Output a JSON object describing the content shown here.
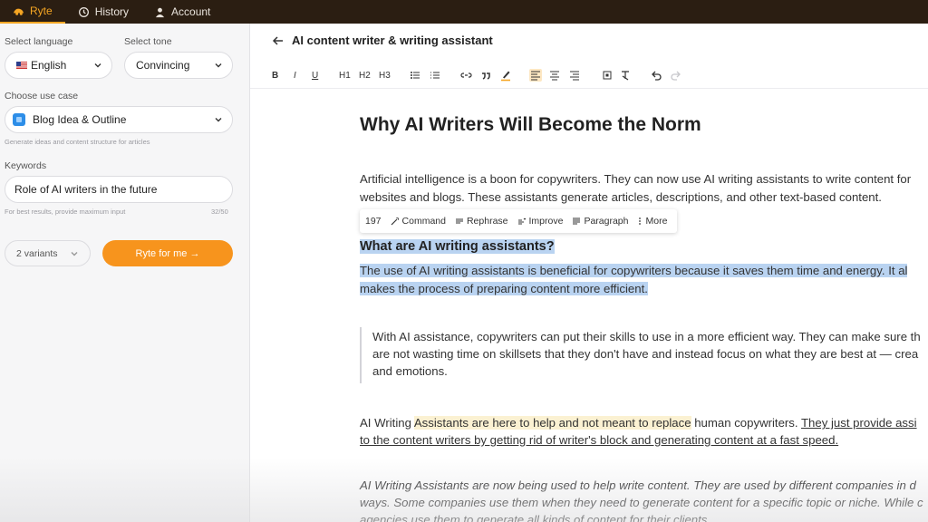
{
  "nav": {
    "tabs": [
      {
        "label": "Ryte",
        "icon": "ryte-logo-icon"
      },
      {
        "label": "History",
        "icon": "history-icon"
      },
      {
        "label": "Account",
        "icon": "user-icon"
      }
    ]
  },
  "sidebar": {
    "language_label": "Select language",
    "language_value": "English",
    "tone_label": "Select tone",
    "tone_value": "Convincing",
    "use_case_label": "Choose use case",
    "use_case_value": "Blog Idea & Outline",
    "use_case_hint": "Generate ideas and content structure for articles",
    "keywords_label": "Keywords",
    "keywords_value": "Role of AI writers in the future",
    "keywords_hint": "For best results, provide maximum input",
    "keywords_count": "32/50",
    "variants_value": "2 variants",
    "ryte_button": "Ryte for me →"
  },
  "main": {
    "title": "AI content writer & writing assistant",
    "toolbar": [
      "B",
      "I",
      "U",
      "H1",
      "H2",
      "H3"
    ],
    "doc_title": "Why AI Writers Will Become the Norm",
    "para1_line1": "Artificial intelligence is a boon for copywriters. They can now use AI writing assistants to write content for",
    "para1_line2": "websites and blogs. These assistants generate articles, descriptions, and other text-based content.",
    "floatbar": {
      "count": "197",
      "command": "Command",
      "rephrase": "Rephrase",
      "improve": "Improve",
      "paragraph": "Paragraph",
      "more": "More"
    },
    "heading2": "What are AI writing assistants?",
    "sel_line1": "The use of AI writing assistants is beneficial for copywriters because it saves them time and energy. It al",
    "sel_line2": "makes the process of preparing content more efficient.",
    "quote_line1": "With AI assistance, copywriters can put their skills to use in a more efficient way. They can make sure th",
    "quote_line2": "are not wasting time on skillsets that they don't have and instead focus on what they are best at — crea",
    "quote_line3": "and emotions.",
    "p3_a": "AI Writing ",
    "p3_hl": "Assistants are here to help and not meant to replace",
    "p3_b": " human copywriters. ",
    "p3_u1": "They just provide assi",
    "p3_u2": "to the content writers by getting rid of writer's block and generating content at a fast speed.",
    "p4_line1": "AI Writing Assistants are now being used to help write content. They are used by different companies in d",
    "p4_line2": "ways. Some companies use them when they need to generate content for a specific topic or niche. While c",
    "p4_line3": "agencies use them to generate all kinds of content for their clients."
  },
  "colors": {
    "accent": "#f7941d",
    "nav_bg": "#2b1e12",
    "selection": "#b9d3f1",
    "highlight": "#fbf1d2"
  }
}
